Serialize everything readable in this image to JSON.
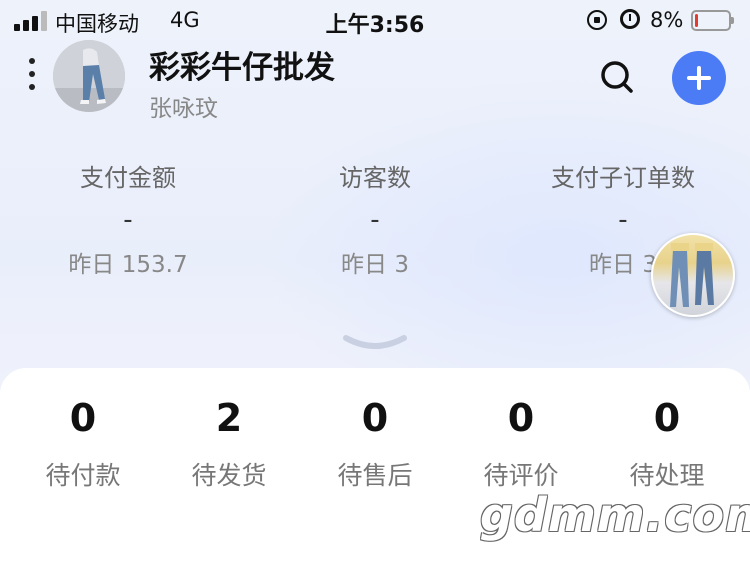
{
  "status_bar": {
    "carrier": "中国移动",
    "network": "4G",
    "time": "上午3:56",
    "battery_percent": "8%",
    "battery_level": 0.08,
    "battery_color": "#e23b2e"
  },
  "header": {
    "shop_name": "彩彩牛仔批发",
    "owner_name": "张咏玟",
    "accent_color": "#4b7cf6"
  },
  "stats": [
    {
      "label": "支付金额",
      "value": "-",
      "yesterday": "昨日 153.7"
    },
    {
      "label": "访客数",
      "value": "-",
      "yesterday": "昨日 3"
    },
    {
      "label": "支付子订单数",
      "value": "-",
      "yesterday": "昨日 3"
    }
  ],
  "orders": [
    {
      "count": "0",
      "label": "待付款"
    },
    {
      "count": "2",
      "label": "待发货"
    },
    {
      "count": "0",
      "label": "待售后"
    },
    {
      "count": "0",
      "label": "待评价"
    },
    {
      "count": "0",
      "label": "待处理"
    }
  ],
  "watermark": "gdmm.com"
}
